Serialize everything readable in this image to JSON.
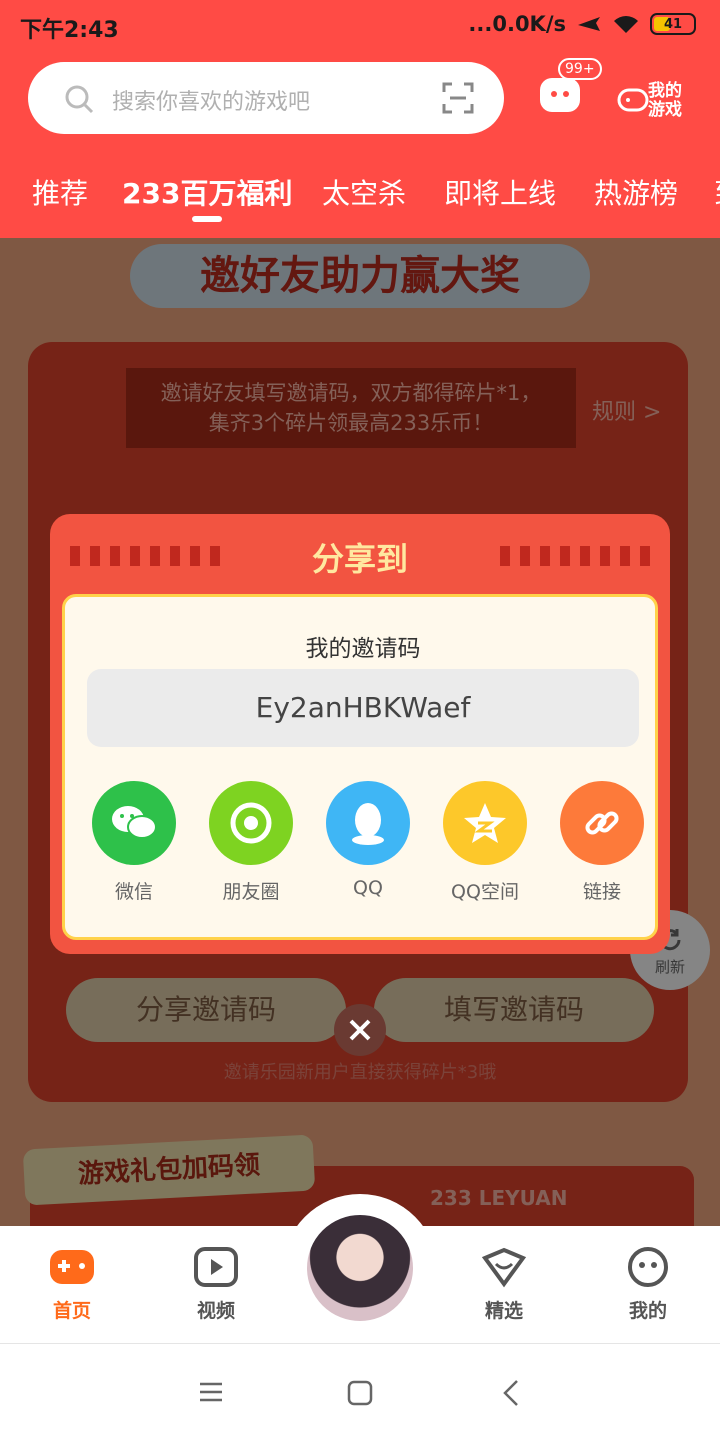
{
  "status_bar": {
    "time": "下午2:43",
    "network": "...0.0K/s",
    "battery": "41"
  },
  "search": {
    "placeholder": "搜索你喜欢的游戏吧"
  },
  "header": {
    "message_badge": "99+",
    "my_games_label": "我的游戏"
  },
  "tabs": [
    "推荐",
    "233百万福利",
    "太空杀",
    "即将上线",
    "热游榜",
    "到"
  ],
  "active_tab": "233百万福利",
  "content": {
    "banner_title": "邀好友助力赢大奖",
    "invite_note_line1": "邀请好友填写邀请码，双方都得碎片*1，",
    "invite_note_line2": "集齐3个碎片领最高233乐币！",
    "rules_link": "规则 >",
    "share_code_button": "分享邀请码",
    "fill_code_button": "填写邀请码",
    "footer_note": "邀请乐园新用户直接获得碎片*3哦",
    "refresh_label": "刷新",
    "gift_label": "游戏礼包加码领",
    "brand_text": "233 LEYUAN"
  },
  "dialog": {
    "title": "分享到",
    "code_label": "我的邀请码",
    "invite_code": "Ey2anHBKWaef",
    "targets": [
      {
        "label": "微信",
        "icon": "wechat-icon",
        "color": "#2ec14a"
      },
      {
        "label": "朋友圈",
        "icon": "moments-icon",
        "color": "#7ed321"
      },
      {
        "label": "QQ",
        "icon": "qq-icon",
        "color": "#3fb6f5"
      },
      {
        "label": "QQ空间",
        "icon": "qzone-icon",
        "color": "#fdc82a"
      },
      {
        "label": "链接",
        "icon": "link-icon",
        "color": "#fd7a3a"
      }
    ]
  },
  "bottom_nav": [
    "首页",
    "视频",
    "精选",
    "我的"
  ],
  "colors": {
    "brand_red": "#ff4b45",
    "active_orange": "#ff6a1a"
  }
}
